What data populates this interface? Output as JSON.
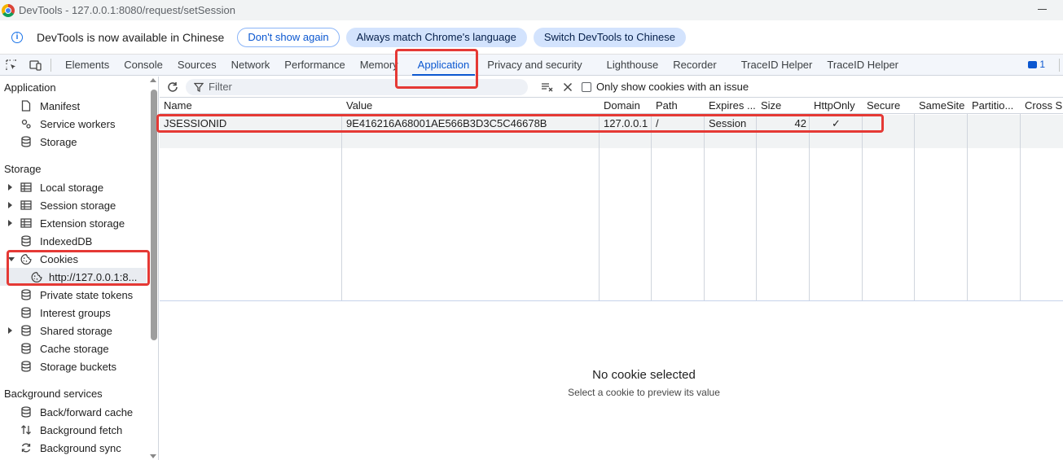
{
  "window": {
    "title": "DevTools - 127.0.0.1:8080/request/setSession"
  },
  "infobar": {
    "message": "DevTools is now available in Chinese",
    "dont_show_again": "Don't show again",
    "always_match": "Always match Chrome's language",
    "switch_language": "Switch DevTools to Chinese"
  },
  "tabs": [
    {
      "label": "Elements"
    },
    {
      "label": "Console"
    },
    {
      "label": "Sources"
    },
    {
      "label": "Network"
    },
    {
      "label": "Performance"
    },
    {
      "label": "Memory"
    },
    {
      "label": "Application",
      "active": true
    },
    {
      "label": "Privacy and security"
    },
    {
      "label": "Lighthouse"
    },
    {
      "label": "Recorder"
    },
    {
      "label": "TraceID Helper"
    },
    {
      "label": "TraceID Helper"
    }
  ],
  "issues_count": "1",
  "sidebar": {
    "application_header": "Application",
    "application_items": [
      {
        "label": "Manifest",
        "icon": "document-icon"
      },
      {
        "label": "Service workers",
        "icon": "gear-icon"
      },
      {
        "label": "Storage",
        "icon": "database-icon"
      }
    ],
    "storage_header": "Storage",
    "storage_items": [
      {
        "label": "Local storage",
        "icon": "table-icon",
        "expandable": true
      },
      {
        "label": "Session storage",
        "icon": "table-icon",
        "expandable": true
      },
      {
        "label": "Extension storage",
        "icon": "table-icon",
        "expandable": true
      },
      {
        "label": "IndexedDB",
        "icon": "database-icon"
      },
      {
        "label": "Cookies",
        "icon": "cookie-icon",
        "expanded": true
      },
      {
        "label": "http://127.0.0.1:8...",
        "icon": "cookie-icon",
        "selected": true
      },
      {
        "label": "Private state tokens",
        "icon": "database-icon"
      },
      {
        "label": "Interest groups",
        "icon": "database-icon"
      },
      {
        "label": "Shared storage",
        "icon": "database-icon",
        "expandable": true
      },
      {
        "label": "Cache storage",
        "icon": "database-icon"
      },
      {
        "label": "Storage buckets",
        "icon": "database-icon"
      }
    ],
    "background_header": "Background services",
    "background_items": [
      {
        "label": "Back/forward cache",
        "icon": "database-icon"
      },
      {
        "label": "Background fetch",
        "icon": "updown-arrow-icon"
      },
      {
        "label": "Background sync",
        "icon": "sync-icon"
      }
    ]
  },
  "toolbar": {
    "filter_placeholder": "Filter",
    "only_issues_label": "Only show cookies with an issue"
  },
  "cookie_table": {
    "columns": [
      "Name",
      "Value",
      "Domain",
      "Path",
      "Expires ...",
      "Size",
      "HttpOnly",
      "Secure",
      "SameSite",
      "Partitio...",
      "Cross Si..."
    ],
    "rows": [
      {
        "name": "JSESSIONID",
        "value": "9E416216A68001AE566B3D3C5C46678B",
        "domain": "127.0.0.1",
        "path": "/",
        "expires": "Session",
        "size": "42",
        "httponly": "✓",
        "secure": "",
        "samesite": "",
        "partition": "",
        "cross_site": ""
      }
    ]
  },
  "preview": {
    "title": "No cookie selected",
    "subtitle": "Select a cookie to preview its value"
  },
  "colors": {
    "accent": "#0b57d0",
    "highlight": "#e53935",
    "row_bg": "#f1f3f4"
  }
}
